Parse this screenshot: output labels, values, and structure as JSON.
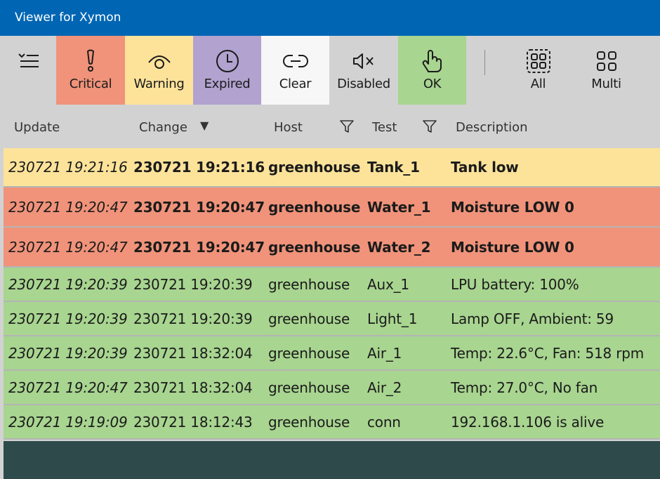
{
  "window": {
    "title": "Viewer for Xymon"
  },
  "toolbar": {
    "buttons": [
      {
        "label": "Critical",
        "icon": "exclamation-icon",
        "color": "#f0937a"
      },
      {
        "label": "Warning",
        "icon": "eye-icon",
        "color": "#fde39a"
      },
      {
        "label": "Expired",
        "icon": "clock-icon",
        "color": "#b1a2cf"
      },
      {
        "label": "Clear",
        "icon": "link-icon",
        "color": "#f7f7f7"
      },
      {
        "label": "Disabled",
        "icon": "mute-icon",
        "color": "#d2d2d2"
      },
      {
        "label": "OK",
        "icon": "thumb-icon",
        "color": "#a8d590"
      },
      {
        "label": "All",
        "icon": "grid-dashed-icon",
        "color": "#d2d2d2"
      },
      {
        "label": "Multi",
        "icon": "grid-icon",
        "color": "#d2d2d2"
      }
    ]
  },
  "table": {
    "columns": [
      "Update",
      "Change",
      "Host",
      "Test",
      "Description"
    ],
    "sort_indicator": "▼",
    "rows": [
      {
        "status": "warning",
        "update": "230721 19:21:16",
        "change": "230721 19:21:16",
        "host": "greenhouse",
        "test": "Tank_1",
        "description": "Tank low"
      },
      {
        "status": "critical",
        "update": "230721 19:20:47",
        "change": "230721 19:20:47",
        "host": "greenhouse",
        "test": "Water_1",
        "description": "Moisture LOW 0"
      },
      {
        "status": "critical",
        "update": "230721 19:20:47",
        "change": "230721 19:20:47",
        "host": "greenhouse",
        "test": "Water_2",
        "description": "Moisture LOW 0"
      },
      {
        "status": "ok",
        "update": "230721 19:20:39",
        "change": "230721 19:20:39",
        "host": "greenhouse",
        "test": "Aux_1",
        "description": "LPU battery: 100%"
      },
      {
        "status": "ok",
        "update": "230721 19:20:39",
        "change": "230721 19:20:39",
        "host": "greenhouse",
        "test": "Light_1",
        "description": "Lamp OFF, Ambient: 59"
      },
      {
        "status": "ok",
        "update": "230721 19:20:39",
        "change": "230721 18:32:04",
        "host": "greenhouse",
        "test": "Air_1",
        "description": "Temp: 22.6°C,  Fan: 518 rpm"
      },
      {
        "status": "ok",
        "update": "230721 19:20:47",
        "change": "230721 18:32:04",
        "host": "greenhouse",
        "test": "Air_2",
        "description": "Temp: 27.0°C,  No fan"
      },
      {
        "status": "ok",
        "update": "230721 19:19:09",
        "change": "230721 18:12:43",
        "host": "greenhouse",
        "test": "conn",
        "description": "192.168.1.106 is alive"
      }
    ]
  },
  "colors": {
    "titlebar": "#0066b4",
    "critical": "#f0937a",
    "warning": "#fde39a",
    "ok": "#a8d590",
    "footer": "#2e4a4a"
  }
}
